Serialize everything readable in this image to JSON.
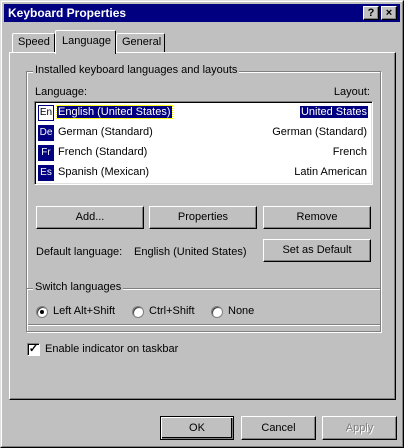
{
  "window": {
    "title": "Keyboard Properties",
    "help_button": "?",
    "close_button": "×"
  },
  "tabs": [
    {
      "label": "Speed",
      "active": false
    },
    {
      "label": "Language",
      "active": true
    },
    {
      "label": "General",
      "active": false
    }
  ],
  "installed": {
    "group_label": "Installed keyboard languages and layouts",
    "col_language": "Language:",
    "col_layout": "Layout:",
    "rows": [
      {
        "code": "En",
        "language": "English (United States)",
        "layout": "United States",
        "selected": true
      },
      {
        "code": "De",
        "language": "German (Standard)",
        "layout": "German (Standard)",
        "selected": false
      },
      {
        "code": "Fr",
        "language": "French (Standard)",
        "layout": "French",
        "selected": false
      },
      {
        "code": "Es",
        "language": "Spanish (Mexican)",
        "layout": "Latin American",
        "selected": false
      }
    ],
    "add_button": "Add...",
    "properties_button": "Properties",
    "remove_button": "Remove",
    "default_label": "Default language:",
    "default_value": "English (United States)",
    "set_default_button": "Set as Default"
  },
  "switch": {
    "group_label": "Switch languages",
    "options": [
      {
        "label": "Left Alt+Shift",
        "selected": true
      },
      {
        "label": "Ctrl+Shift",
        "selected": false
      },
      {
        "label": "None",
        "selected": false
      }
    ]
  },
  "indicator": {
    "label": "Enable indicator on taskbar",
    "checked": true
  },
  "footer": {
    "ok": "OK",
    "cancel": "Cancel",
    "apply": "Apply"
  }
}
